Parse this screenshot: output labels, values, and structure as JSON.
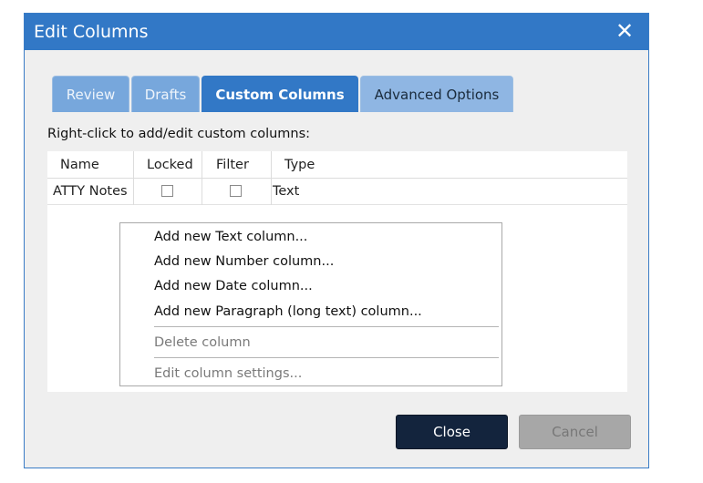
{
  "dialog": {
    "title": "Edit Columns",
    "close_glyph": "✕"
  },
  "tabs": [
    {
      "label": "Review",
      "active": false
    },
    {
      "label": "Drafts",
      "active": false
    },
    {
      "label": "Custom Columns",
      "active": true
    },
    {
      "label": "Advanced Options",
      "active": false
    }
  ],
  "hint_text": "Right-click to add/edit custom columns:",
  "grid": {
    "headers": [
      "Name",
      "Locked",
      "Filter",
      "Type"
    ],
    "rows": [
      {
        "name": "ATTY Notes",
        "locked": false,
        "filter": false,
        "type": "Text"
      }
    ]
  },
  "context_menu": {
    "items": [
      {
        "label": "Add new Text column...",
        "enabled": true
      },
      {
        "label": "Add new Number column...",
        "enabled": true
      },
      {
        "label": "Add new Date column...",
        "enabled": true
      },
      {
        "label": "Add new Paragraph (long text) column...",
        "enabled": true
      },
      {
        "label": "Delete column",
        "enabled": false
      },
      {
        "label": "Edit column settings...",
        "enabled": false
      }
    ]
  },
  "buttons": {
    "close_label": "Close",
    "cancel_label": "Cancel"
  },
  "colors": {
    "titlebar": "#3278c6",
    "active_tab": "#3278c6",
    "inactive_tab": "#77a7dc",
    "close_button": "#13243d",
    "cancel_button": "#a7a7a7"
  }
}
